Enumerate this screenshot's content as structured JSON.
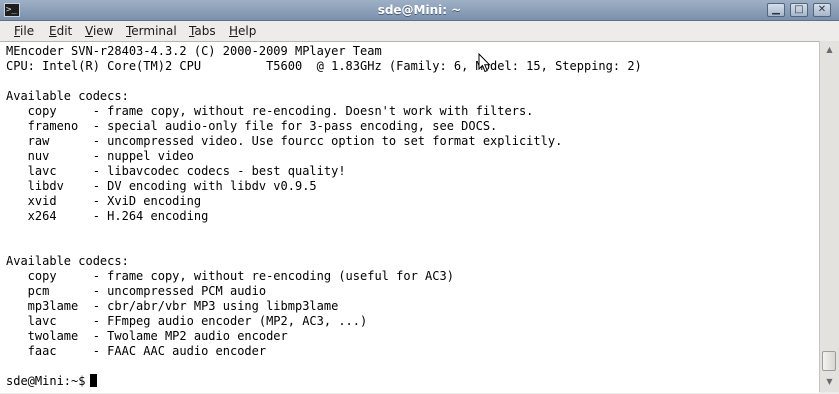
{
  "window": {
    "title": "sde@Mini: ~"
  },
  "title_buttons": {
    "minimize": "▁",
    "maximize": "□",
    "close": "✕"
  },
  "menu": {
    "items": [
      {
        "label": "File",
        "mnemonic": "F",
        "rest": "ile"
      },
      {
        "label": "Edit",
        "mnemonic": "E",
        "rest": "dit"
      },
      {
        "label": "View",
        "mnemonic": "V",
        "rest": "iew"
      },
      {
        "label": "Terminal",
        "mnemonic": "T",
        "rest": "erminal"
      },
      {
        "label": "Tabs",
        "mnemonic": "T",
        "rest": "abs"
      },
      {
        "label": "Help",
        "mnemonic": "H",
        "rest": "elp"
      }
    ]
  },
  "terminal": {
    "lines": [
      "MEncoder SVN-r28403-4.3.2 (C) 2000-2009 MPlayer Team",
      "CPU: Intel(R) Core(TM)2 CPU         T5600  @ 1.83GHz (Family: 6, Model: 15, Stepping: 2)",
      "",
      "Available codecs:",
      "   copy     - frame copy, without re-encoding. Doesn't work with filters.",
      "   frameno  - special audio-only file for 3-pass encoding, see DOCS.",
      "   raw      - uncompressed video. Use fourcc option to set format explicitly.",
      "   nuv      - nuppel video",
      "   lavc     - libavcodec codecs - best quality!",
      "   libdv    - DV encoding with libdv v0.9.5",
      "   xvid     - XviD encoding",
      "   x264     - H.264 encoding",
      "",
      "",
      "Available codecs:",
      "   copy     - frame copy, without re-encoding (useful for AC3)",
      "   pcm      - uncompressed PCM audio",
      "   mp3lame  - cbr/abr/vbr MP3 using libmp3lame",
      "   lavc     - FFmpeg audio encoder (MP2, AC3, ...)",
      "   twolame  - Twolame MP2 audio encoder",
      "   faac     - FAAC AAC audio encoder",
      "",
      "sde@Mini:~$ "
    ]
  },
  "icons": {
    "app": "terminal-icon",
    "pointer": "mouse-pointer-icon",
    "scroll_up": "scroll-up-arrow-icon",
    "scroll_down": "scroll-down-arrow-icon"
  },
  "colors": {
    "titlebar": "#8ea2bb",
    "terminal_bg": "#ffffff",
    "terminal_fg": "#000000"
  }
}
